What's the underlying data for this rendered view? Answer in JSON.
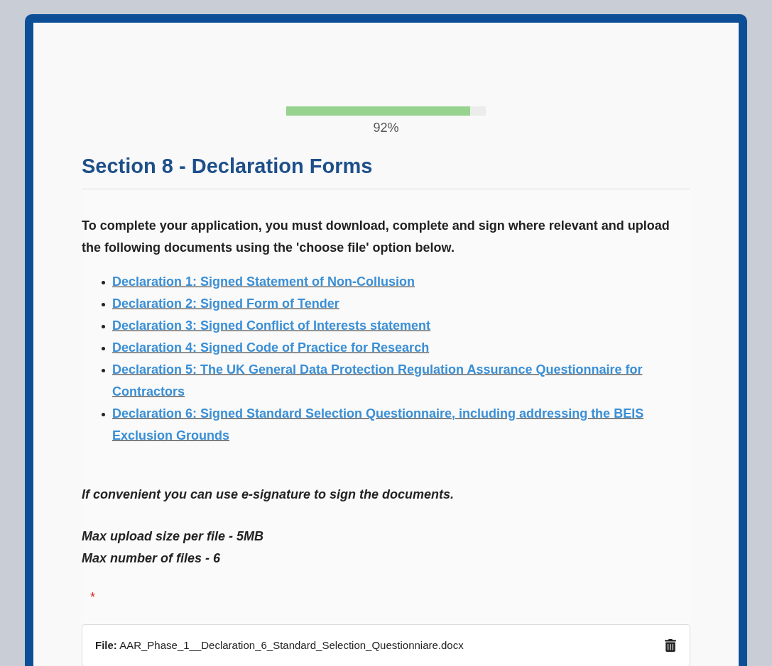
{
  "progress": {
    "level": 0.92,
    "reading": "92%"
  },
  "section_title": "Section 8 - Declaration Forms",
  "intro": "To complete your application, you must download, complete and sign where relevant and upload the following documents using the 'choose file' option below.",
  "declarations": [
    {
      "label": "Declaration 1: Signed Statement of Non-Collusion"
    },
    {
      "label": "Declaration 2: Signed Form of Tender"
    },
    {
      "label": "Declaration 3: Signed Conflict of Interests statement"
    },
    {
      "label": "Declaration 4: Signed Code of Practice for Research"
    },
    {
      "label": "Declaration 5: The UK General Data Protection Regulation Assurance Questionnaire for Contractors"
    },
    {
      "label": "Declaration 6: Signed Standard Selection Questionnaire, including addressing the BEIS Exclusion Grounds"
    }
  ],
  "esignature_note": "If convenient you can use e-signature to sign the documents.",
  "limits": [
    "Max upload size per file - 5MB",
    "Max number of files - 6"
  ],
  "required_mark": "*",
  "uploaded_files": [
    {
      "text": "**File:** AAR_Phase_1__Declaration_6_Standard_Selection_Questionniare.docx"
    }
  ]
}
